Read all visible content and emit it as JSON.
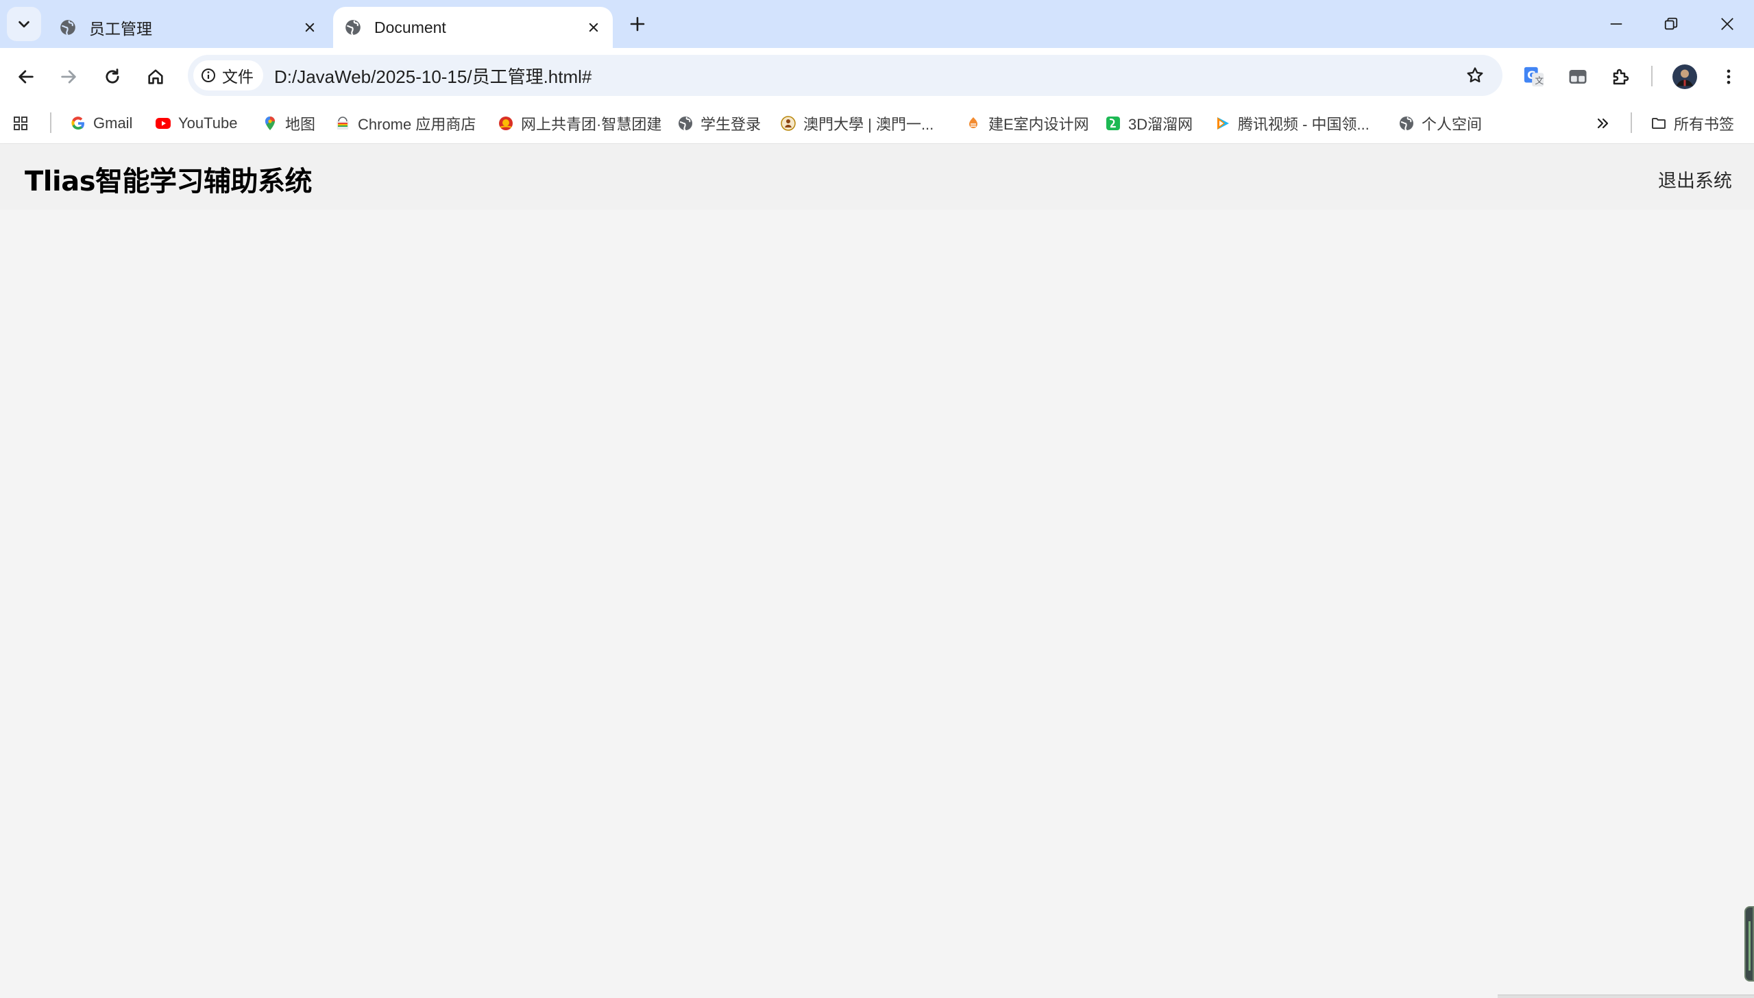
{
  "browser": {
    "tabs": [
      {
        "title": "员工管理",
        "active": false
      },
      {
        "title": "Document",
        "active": true
      }
    ],
    "omnibox": {
      "chip_label": "文件",
      "url": "D:/JavaWeb/2025-10-15/员工管理.html#"
    },
    "bookmarks": [
      {
        "label": "Gmail",
        "icon": "google-icon"
      },
      {
        "label": "YouTube",
        "icon": "youtube-icon"
      },
      {
        "label": "地图",
        "icon": "maps-pin-icon"
      },
      {
        "label": "Chrome 应用商店",
        "icon": "chrome-webstore-icon"
      },
      {
        "label": "网上共青团·智慧团建",
        "icon": "youth-league-icon"
      },
      {
        "label": "学生登录",
        "icon": "globe-icon"
      },
      {
        "label": "澳門大學 | 澳門一...",
        "icon": "university-seal-icon"
      },
      {
        "label": "建E室内设计网",
        "icon": "jiane-icon"
      },
      {
        "label": "3D溜溜网",
        "icon": "3d-liuliu-icon"
      },
      {
        "label": "腾讯视频 - 中国领...",
        "icon": "tencent-video-icon"
      },
      {
        "label": "个人空间",
        "icon": "globe-icon"
      }
    ],
    "all_bookmarks_label": "所有书签",
    "colors": {
      "tabstrip_bg": "#d3e3fd",
      "omnibox_bg": "#edf2fa",
      "page_bg": "#f4f4f4"
    }
  },
  "page": {
    "title": "Tlias智能学习辅助系统",
    "logout_label": "退出系统"
  }
}
